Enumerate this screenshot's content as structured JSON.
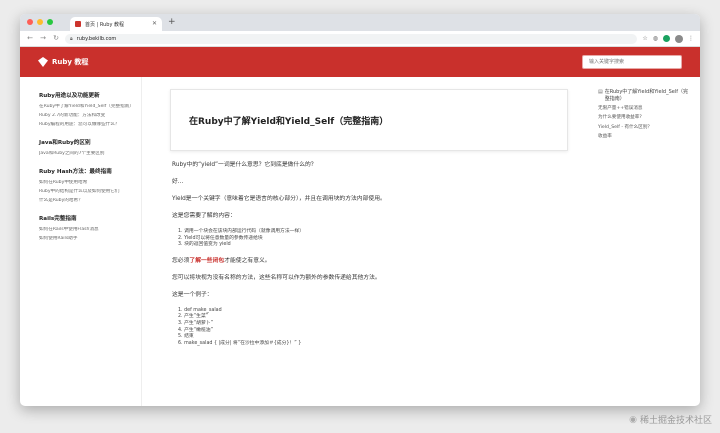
{
  "browser": {
    "tab_title": "首页 | Ruby 教程",
    "url": "ruby.bekilb.com",
    "colors": {
      "close": "#fe5f57",
      "minimize": "#febc2e",
      "maximize": "#28c840",
      "brand": "#c9302c"
    }
  },
  "header": {
    "site_title": "Ruby 教程",
    "search_placeholder": "输入关键字搜索"
  },
  "sidebar": {
    "sections": [
      {
        "heading": "Ruby用途以及功能更新",
        "items": [
          "在Ruby中了解Yield和Yield_Self（完整指南）",
          "Ruby 2.7的新功能：方法和改变",
          "Ruby编程的用途：您可以做哪些什么？"
        ]
      },
      {
        "heading": "Java和Ruby的区别",
        "items": [
          "Java和Ruby之间的7个主要区别"
        ]
      },
      {
        "heading": "Ruby Hash方法：最终指南",
        "items": [
          "如何在Ruby中使用哈希",
          "Ruby中的结构是什么以及如何使用它们",
          "什么是Ruby的哈希？"
        ]
      },
      {
        "heading": "Rails完整指南",
        "items": [
          "如何在Rails中使用Flash消息",
          "如何使用Rails助手"
        ]
      }
    ]
  },
  "main": {
    "title": "在Ruby中了解Yield和Yield_Self（完整指南）",
    "p1": "Ruby中的“yield”一词是什么意思？它到底是做什么的？",
    "p2": "好...",
    "p3": "Yield是一个关键字（意味着它是语言的核心部分），并且在调用块的方法内部使用。",
    "p4": "这是您需要了解的内容：",
    "list1": [
      "1. 调用一个块会在该块内部运行代码（就像调用方法一样）",
      "2. Yield可以将任意数量的参数传递给块",
      "3. 块的返回值变为 yield"
    ],
    "p5_before": "您必须",
    "p5_link": "了解一些闭包",
    "p5_after": "才能使之有意义。",
    "p6": "您可以将块视为没有名称的方法，这些名称可以作为额外的参数传递给其他方法。",
    "p7": "这是一个例子：",
    "code": [
      "1. def make_salad",
      "2. 产生“生菜”",
      "3. 产生“胡萝卜”",
      "4. 产生“橄榄油”",
      "5. 结束",
      "6. make_salad { |成分| 将“在沙拉中添加＃{成分}！” }"
    ]
  },
  "toc": {
    "title": "在Ruby中了解Yield和Yield_Self（完整指南）",
    "items": [
      "无限产量++错误消息",
      "为什么要使用收益率?",
      "Yield_Self - 有什么区别？",
      "收益率"
    ]
  },
  "watermark": "稀土掘金技术社区"
}
